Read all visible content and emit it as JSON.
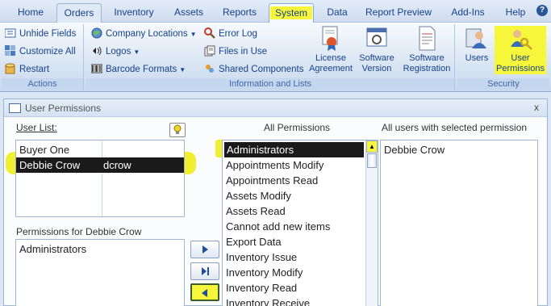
{
  "tabs": [
    {
      "label": "Home"
    },
    {
      "label": "Orders"
    },
    {
      "label": "Inventory"
    },
    {
      "label": "Assets"
    },
    {
      "label": "Reports"
    },
    {
      "label": "System"
    },
    {
      "label": "Data"
    },
    {
      "label": "Report Preview"
    },
    {
      "label": "Add-Ins"
    },
    {
      "label": "Help"
    }
  ],
  "help_icon": "?",
  "ribbon": {
    "actions": {
      "label": "Actions",
      "buttons": [
        "Unhide Fields",
        "Customize All",
        "Restart"
      ]
    },
    "info": {
      "label": "Information and Lists",
      "col1": [
        "Company Locations",
        "Logos",
        "Barcode Formats"
      ],
      "col2": [
        "Error Log",
        "Files in Use",
        "Shared Components"
      ],
      "big": [
        {
          "l1": "License",
          "l2": "Agreement"
        },
        {
          "l1": "Software",
          "l2": "Version"
        },
        {
          "l1": "Software",
          "l2": "Registration"
        }
      ]
    },
    "security": {
      "label": "Security",
      "users": "Users",
      "user_perm_l1": "User",
      "user_perm_l2": "Permissions"
    }
  },
  "dialog": {
    "title": "User Permissions",
    "close": "x",
    "user_list_label": "User List:",
    "users": [
      {
        "name": "Buyer One",
        "login": ""
      },
      {
        "name": "Debbie Crow",
        "login": "dcrow"
      }
    ],
    "perms_for_label": "Permissions for Debbie Crow",
    "user_perms": [
      "Administrators"
    ],
    "all_perms_label": "All Permissions",
    "all_perms": [
      "Administrators",
      "Appointments Modify",
      "Appointments Read",
      "Assets Modify",
      "Assets Read",
      "Cannot add new items",
      "Export Data",
      "Inventory Issue",
      "Inventory Modify",
      "Inventory Read",
      "Inventory Receive"
    ],
    "users_with_label": "All users with selected permission",
    "users_with": [
      "Debbie Crow"
    ]
  },
  "colors": {
    "highlight": "#f6f63a",
    "selection": "#1a1a1a",
    "ribbon_text": "#15428b"
  }
}
